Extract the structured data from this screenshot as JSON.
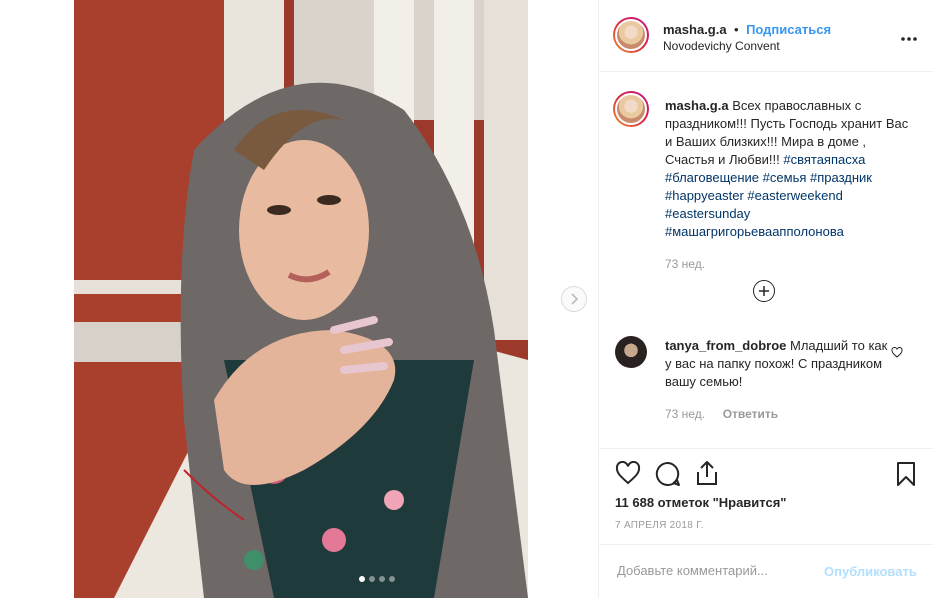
{
  "post": {
    "photo_alt": "masha.g.a post photo",
    "carousel_count": 4,
    "carousel_active_index": 1
  },
  "header": {
    "username": "masha.g.a",
    "separator": "•",
    "follow_label": "Подписаться",
    "location": "Novodevichy Convent",
    "more_icon": "more-horizontal-icon"
  },
  "caption": {
    "username": "masha.g.a",
    "text": "Всех православных с праздником!!! Пусть Господь хранит Вас и Ваших близких!!! Мира в доме , Счастья и Любви!!!",
    "hashtags": [
      "#святаяпасха",
      "#благовещение",
      "#семья",
      "#праздник",
      "#happyeaster",
      "#easterweekend",
      "#eastersunday",
      "#машагригорьеваапполонова"
    ],
    "time": "73 нед."
  },
  "load_more_icon": "plus-circle-icon",
  "comment": {
    "username": "tanya_from_dobroe",
    "text": "Младший то как у вас на папку похож! С праздником вашу семью!",
    "time": "73 нед.",
    "reply_label": "Ответить"
  },
  "actions": {
    "like_icon": "heart-icon",
    "comment_icon": "comment-icon",
    "share_icon": "share-icon",
    "save_icon": "bookmark-icon"
  },
  "likes_text": "11 688 отметок \"Нравится\"",
  "date_text": "7 АПРЕЛЯ 2018 Г.",
  "comment_box": {
    "placeholder": "Добавьте комментарий...",
    "publish_label": "Опубликовать"
  },
  "colors": {
    "link": "#3897f0",
    "hashtag": "#003569",
    "muted": "#999999",
    "publish_disabled": "#b2dffc"
  }
}
